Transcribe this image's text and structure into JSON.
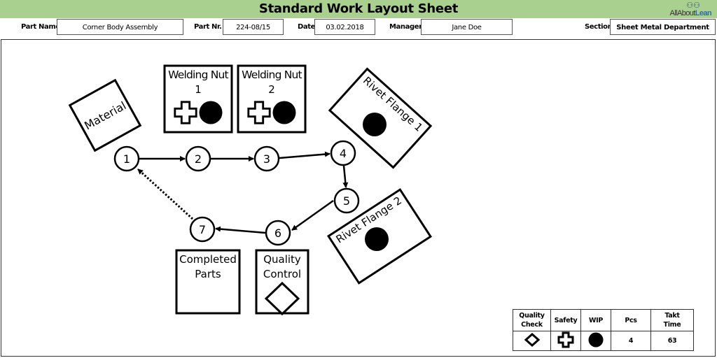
{
  "header": {
    "title": "Standard Work Layout Sheet",
    "logo": {
      "prefix": "AllAbout",
      "accent": "Lean",
      "icon": "people-group-icon"
    },
    "fields": {
      "part_name": {
        "label": "Part Name",
        "value": "Corner Body Assembly"
      },
      "part_nr": {
        "label": "Part Nr.",
        "value": "224-08/15"
      },
      "date": {
        "label": "Date",
        "value": "03.02.2018"
      },
      "manager": {
        "label": "Manager",
        "value": "Jane Doe"
      },
      "section": {
        "label": "Section",
        "value": "Sheet Metal Department"
      }
    },
    "accent_color": "#a9d08e"
  },
  "diagram": {
    "stations": {
      "material": {
        "label": "Material"
      },
      "welding_nut_1": {
        "line1": "Welding Nut",
        "line2": "1",
        "symbols": [
          "safety",
          "wip"
        ]
      },
      "welding_nut_2": {
        "line1": "Welding Nut",
        "line2": "2",
        "symbols": [
          "safety",
          "wip"
        ]
      },
      "rivet_flange_1": {
        "label": "Rivet Flange 1",
        "symbols": [
          "wip"
        ]
      },
      "rivet_flange_2": {
        "label": "Rivet Flange 2",
        "symbols": [
          "wip"
        ]
      },
      "completed_parts": {
        "line1": "Completed",
        "line2": "Parts"
      },
      "quality_control": {
        "line1": "Quality",
        "line2": "Control",
        "symbols": [
          "quality-check"
        ]
      }
    },
    "steps": [
      "1",
      "2",
      "3",
      "4",
      "5",
      "6",
      "7"
    ],
    "flow": [
      {
        "from": "1",
        "to": "2",
        "style": "solid"
      },
      {
        "from": "2",
        "to": "3",
        "style": "solid"
      },
      {
        "from": "3",
        "to": "4",
        "style": "solid"
      },
      {
        "from": "4",
        "to": "5",
        "style": "solid"
      },
      {
        "from": "5",
        "to": "6",
        "style": "solid"
      },
      {
        "from": "6",
        "to": "7",
        "style": "solid"
      },
      {
        "from": "7",
        "to": "1",
        "style": "dotted"
      }
    ]
  },
  "legend": {
    "headers": [
      "Quality\nCheck",
      "Safety",
      "WIP",
      "Pcs",
      "Takt\nTime"
    ],
    "header_lines": [
      [
        "Quality",
        "Check"
      ],
      [
        "Safety"
      ],
      [
        "WIP"
      ],
      [
        "Pcs"
      ],
      [
        "Takt",
        "Time"
      ]
    ],
    "symbols": [
      "quality-check-icon",
      "safety-cross-icon",
      "wip-dot-icon"
    ],
    "pcs": "4",
    "takt_time": "63"
  }
}
